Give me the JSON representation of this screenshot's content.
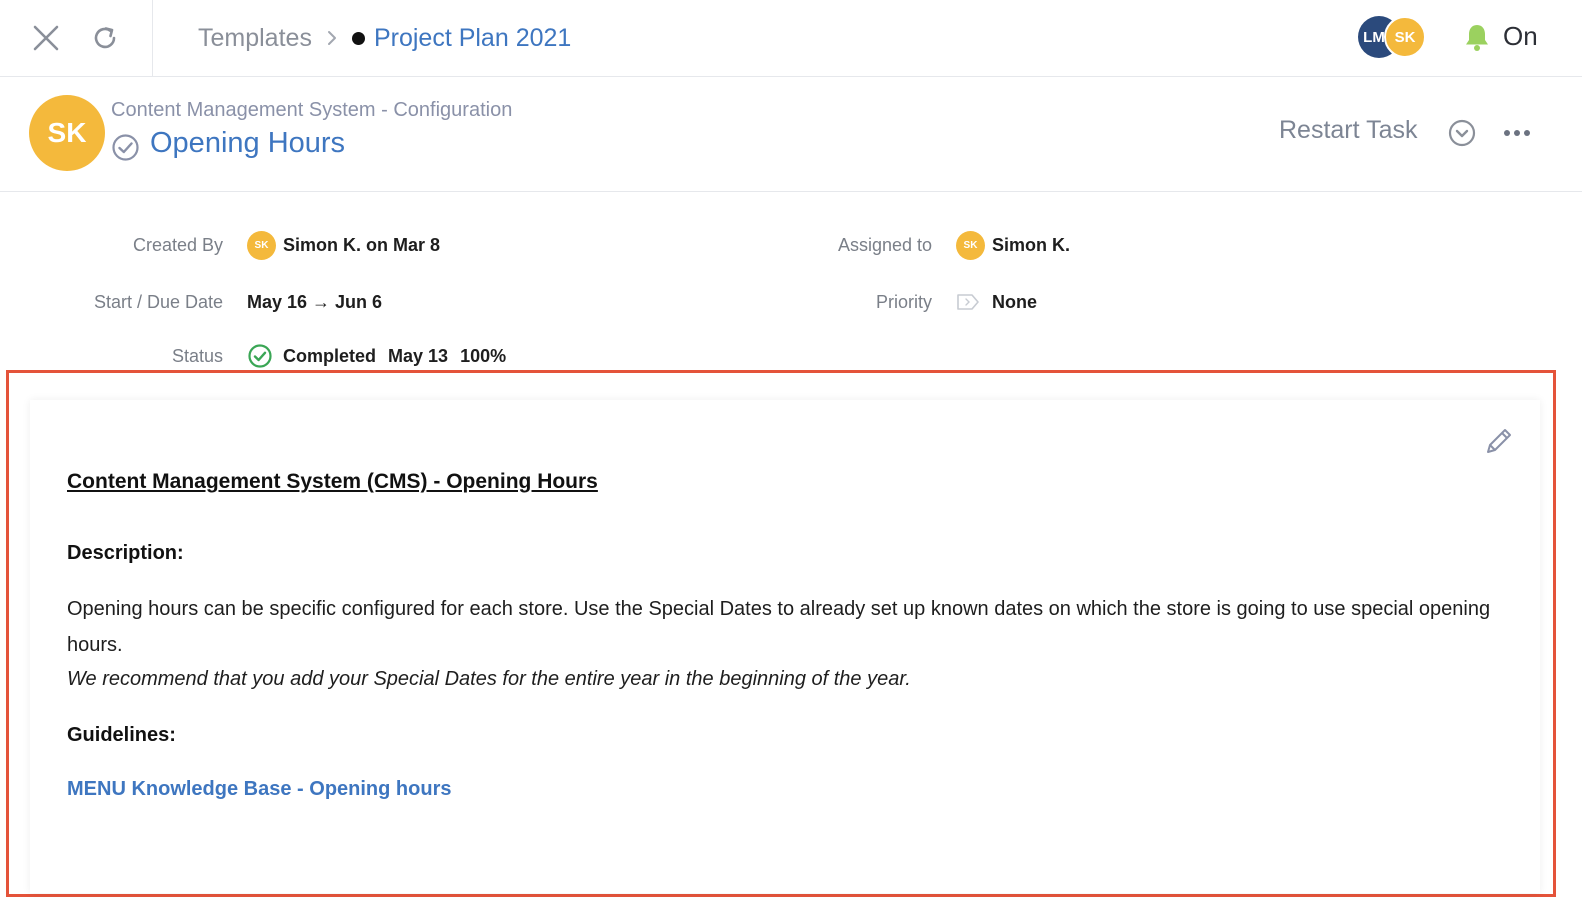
{
  "topbar": {
    "breadcrumb_root": "Templates",
    "breadcrumb_current": "Project Plan 2021",
    "avatars": [
      "LM",
      "SK"
    ],
    "notifications_label": "On"
  },
  "task": {
    "avatar_initials": "SK",
    "parent": "Content Management System - Configuration",
    "title": "Opening Hours",
    "restart_label": "Restart Task"
  },
  "meta": {
    "created_by_label": "Created By",
    "created_by_avatar": "SK",
    "created_by_value": "Simon K. on Mar 8",
    "dates_label": "Start / Due Date",
    "dates_value": "May 16 → Jun 6",
    "status_label": "Status",
    "status_value": "Completed",
    "status_date": "May 13",
    "status_percent": "100%",
    "assigned_label": "Assigned to",
    "assigned_avatar": "SK",
    "assigned_value": "Simon K.",
    "priority_label": "Priority",
    "priority_value": "None"
  },
  "content": {
    "title": "Content Management System (CMS) - Opening Hours",
    "description_heading": "Description:",
    "description_text": "Opening hours can be specific configured for each store. Use the Special Dates to already set up known dates on which the store is going to use special opening hours.",
    "recommendation": "We recommend that you add your Special Dates for the entire year in the beginning of the year.",
    "guidelines_heading": "Guidelines:",
    "guidelines_link": "MENU Knowledge Base - Opening hours"
  },
  "colors": {
    "accent": "#3e76c0",
    "avatar_yellow": "#f4b93c",
    "avatar_navy": "#2b4a7c",
    "completed_green": "#3aa655",
    "highlight_red": "#e4533a"
  },
  "icons": [
    "close-icon",
    "refresh-icon",
    "chevron-right-icon",
    "bell-icon",
    "check-circle-icon",
    "more-icon",
    "priority-flag-icon",
    "pencil-icon"
  ]
}
